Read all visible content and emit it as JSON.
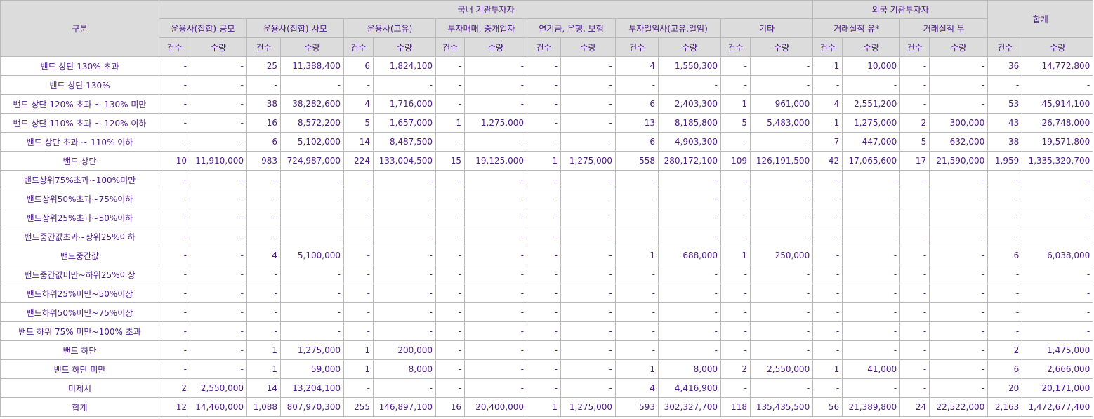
{
  "header": {
    "category": "구분",
    "domestic": "국내 기관투자자",
    "foreign": "외국 기관투자자",
    "total": "합계",
    "groups": [
      "운용사(집합)-공모",
      "운용사(집합)-사모",
      "운용사(고유)",
      "투자매매, 중개업자",
      "연기금, 은행, 보험",
      "투자일임사(고유,일임)",
      "기타",
      "거래실적 유*",
      "거래실적 무"
    ],
    "count_label": "건수",
    "qty_label": "수량"
  },
  "rows": [
    {
      "label": "밴드 상단 130% 초과",
      "cells": [
        "-",
        "-",
        "25",
        "11,388,400",
        "6",
        "1,824,100",
        "-",
        "-",
        "-",
        "-",
        "4",
        "1,550,300",
        "-",
        "-",
        "1",
        "10,000",
        "-",
        "-",
        "36",
        "14,772,800"
      ]
    },
    {
      "label": "밴드 상단 130%",
      "cells": [
        "-",
        "-",
        "-",
        "-",
        "-",
        "-",
        "-",
        "-",
        "-",
        "-",
        "-",
        "-",
        "-",
        "-",
        "-",
        "-",
        "-",
        "-",
        "-",
        "-"
      ]
    },
    {
      "label": "밴드 상단 120% 초과 ~ 130% 미만",
      "cells": [
        "-",
        "-",
        "38",
        "38,282,600",
        "4",
        "1,716,000",
        "-",
        "-",
        "-",
        "-",
        "6",
        "2,403,300",
        "1",
        "961,000",
        "4",
        "2,551,200",
        "-",
        "-",
        "53",
        "45,914,100"
      ]
    },
    {
      "label": "밴드 상단 110% 초과 ~ 120% 이하",
      "cells": [
        "-",
        "-",
        "16",
        "8,572,200",
        "5",
        "1,657,000",
        "1",
        "1,275,000",
        "-",
        "-",
        "13",
        "8,185,800",
        "5",
        "5,483,000",
        "1",
        "1,275,000",
        "2",
        "300,000",
        "43",
        "26,748,000"
      ]
    },
    {
      "label": "밴드 상단 초과 ~ 110% 이하",
      "cells": [
        "-",
        "-",
        "6",
        "5,102,000",
        "14",
        "8,487,500",
        "-",
        "-",
        "-",
        "-",
        "6",
        "4,903,300",
        "-",
        "-",
        "7",
        "447,000",
        "5",
        "632,000",
        "38",
        "19,571,800"
      ]
    },
    {
      "label": "밴드 상단",
      "cells": [
        "10",
        "11,910,000",
        "983",
        "724,987,000",
        "224",
        "133,004,500",
        "15",
        "19,125,000",
        "1",
        "1,275,000",
        "558",
        "280,172,100",
        "109",
        "126,191,500",
        "42",
        "17,065,600",
        "17",
        "21,590,000",
        "1,959",
        "1,335,320,700"
      ]
    },
    {
      "label": "밴드상위75%초과~100%미만",
      "cells": [
        "-",
        "-",
        "-",
        "-",
        "-",
        "-",
        "-",
        "-",
        "-",
        "-",
        "-",
        "-",
        "-",
        "-",
        "-",
        "-",
        "-",
        "-",
        "-",
        "-"
      ]
    },
    {
      "label": "밴드상위50%초과~75%이하",
      "cells": [
        "-",
        "-",
        "-",
        "-",
        "-",
        "-",
        "-",
        "-",
        "-",
        "-",
        "-",
        "-",
        "-",
        "-",
        "-",
        "-",
        "-",
        "-",
        "-",
        "-"
      ]
    },
    {
      "label": "밴드상위25%초과~50%이하",
      "cells": [
        "-",
        "-",
        "-",
        "-",
        "-",
        "-",
        "-",
        "-",
        "-",
        "-",
        "-",
        "-",
        "-",
        "-",
        "-",
        "-",
        "-",
        "-",
        "-",
        "-"
      ]
    },
    {
      "label": "밴드중간값초과~상위25%이하",
      "cells": [
        "-",
        "-",
        "-",
        "-",
        "-",
        "-",
        "-",
        "-",
        "-",
        "-",
        "-",
        "-",
        "-",
        "-",
        "-",
        "-",
        "-",
        "-",
        "-",
        "-"
      ]
    },
    {
      "label": "밴드중간값",
      "cells": [
        "-",
        "-",
        "4",
        "5,100,000",
        "-",
        "-",
        "-",
        "-",
        "-",
        "-",
        "1",
        "688,000",
        "1",
        "250,000",
        "-",
        "-",
        "-",
        "-",
        "6",
        "6,038,000"
      ]
    },
    {
      "label": "밴드중간값미만~하위25%이상",
      "cells": [
        "-",
        "-",
        "-",
        "-",
        "-",
        "-",
        "-",
        "-",
        "-",
        "-",
        "-",
        "-",
        "-",
        "-",
        "-",
        "-",
        "-",
        "-",
        "-",
        "-"
      ]
    },
    {
      "label": "밴드하위25%미만~50%이상",
      "cells": [
        "-",
        "-",
        "-",
        "-",
        "-",
        "-",
        "-",
        "-",
        "-",
        "-",
        "-",
        "-",
        "-",
        "-",
        "-",
        "-",
        "-",
        "-",
        "-",
        "-"
      ]
    },
    {
      "label": "밴드하위50%미만~75%이상",
      "cells": [
        "-",
        "-",
        "-",
        "-",
        "-",
        "-",
        "-",
        "-",
        "-",
        "-",
        "-",
        "-",
        "-",
        "-",
        "-",
        "-",
        "-",
        "-",
        "-",
        "-"
      ]
    },
    {
      "label": "밴드 하위 75% 미만~100% 초과",
      "cells": [
        "-",
        "-",
        "-",
        "-",
        "-",
        "-",
        "-",
        "-",
        "-",
        "-",
        "-",
        "-",
        "-",
        "-",
        "-",
        "-",
        "-",
        "-",
        "-",
        "-"
      ]
    },
    {
      "label": "밴드 하단",
      "cells": [
        "-",
        "-",
        "1",
        "1,275,000",
        "1",
        "200,000",
        "-",
        "-",
        "-",
        "-",
        "-",
        "-",
        "-",
        "-",
        "-",
        "-",
        "-",
        "-",
        "2",
        "1,475,000"
      ]
    },
    {
      "label": "밴드 하단 미만",
      "cells": [
        "-",
        "-",
        "1",
        "59,000",
        "1",
        "8,000",
        "-",
        "-",
        "-",
        "-",
        "1",
        "8,000",
        "2",
        "2,550,000",
        "1",
        "41,000",
        "-",
        "-",
        "6",
        "2,666,000"
      ]
    },
    {
      "label": "미제시",
      "cells": [
        "2",
        "2,550,000",
        "14",
        "13,204,100",
        "-",
        "-",
        "-",
        "-",
        "-",
        "-",
        "4",
        "4,416,900",
        "-",
        "-",
        "-",
        "-",
        "-",
        "-",
        "20",
        "20,171,000"
      ]
    },
    {
      "label": "합계",
      "cells": [
        "12",
        "14,460,000",
        "1,088",
        "807,970,300",
        "255",
        "146,897,100",
        "16",
        "20,400,000",
        "1",
        "1,275,000",
        "593",
        "302,327,700",
        "118",
        "135,435,500",
        "56",
        "21,389,800",
        "24",
        "22,522,000",
        "2,163",
        "1,472,677,400"
      ]
    }
  ]
}
